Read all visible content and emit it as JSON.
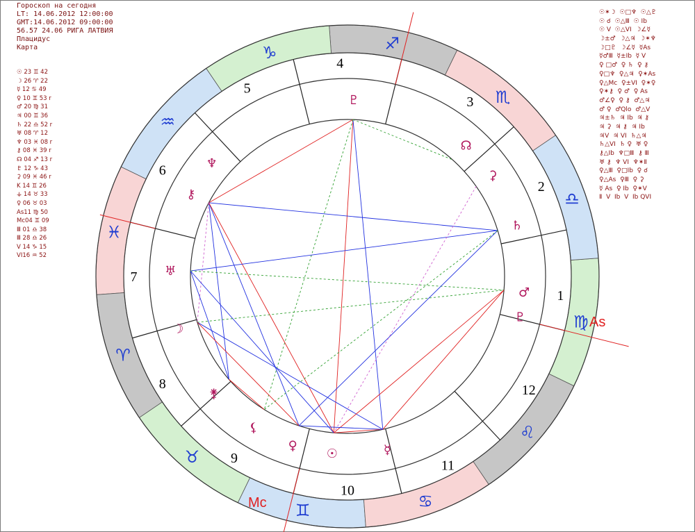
{
  "header": {
    "lines": [
      "Гороскоп на сегодня",
      "LT: 14.06.2012 12:00:00",
      "GMT:14.06.2012 09:00:00",
      "56.57 24.06 РИГА ЛАТВИЯ",
      "Плацидус",
      "Карта"
    ]
  },
  "planet_positions": [
    "☉ 23 ♊ 42",
    "☽ 26 ♈ 22",
    "☿ 12 ♋ 49",
    "♀ 10 ♊ 53 r",
    "♂ 20 ♍ 31",
    "♃ 00 ♊ 36",
    "♄ 22 ♎ 52 r",
    "♅ 08 ♈ 12",
    "♆ 03 ♓ 08 r",
    "⚷ 08 ♓ 39 r",
    "☊ 04 ♐ 13 r",
    "♇ 12 ♑ 43",
    "⚳ 09 ♓ 46 r",
    "K 14 ♊ 26",
    "⚶ 14 ♉ 33",
    "♀ 06 ♉ 03",
    "As11 ♍ 50",
    "Mc04 ♊ 09",
    "Ⅲ 01 ♎ 38",
    "Ⅲ 28 ♎ 26",
    "V 14 ♑ 15",
    "VI16 ♒ 52"
  ],
  "aspect_grid": [
    "☉✶☽  ☉□♆  ☉△♇",
    "☉ ☌  ☉△Ⅲ  ☉ Ib",
    "☉ V  ☉△VI  ☽∠☿",
    "☽±♂  ☽△♃  ☽✶♆",
    "☽□♇  ☽∠☿  ☿As",
    "☿♂Ⅲ  ☿±Ib  ☿ V",
    "♀ □♂  ♀ ♄  ♀ ⚷",
    "♀□♆  ♀△♃  ♀✶As",
    "♀△Mc  ♀±VI  ♀✶♀",
    "♀✶⚷  ♀ ♂  ♀ As",
    "♂∠♀  ♀ ⚷  ♂△♃",
    "♂ ♀  ♂Qlo  ♂△V",
    "♃±♄  ♃ Ib  ♃ ⚷",
    "♃ ⚳  ♃ ⚷  ♃ Ib",
    "♃V  ♃ VI  ♄△♃",
    "♄△VI  ♄ ♀  ♅ ♀",
    "⚷△Ib  ♆□Ⅲ  ⚷ Ⅲ",
    "♅ ⚷  ♆ VI  ♆✶Ⅱ",
    "♀△Ⅲ  ♀□Ib  ♀ ☌",
    "♀△As  ♀Ⅲ  ♀ ⚳",
    "☿ As  ♀ Ib  ♀✶V",
    "Ⅱ  V  Ib  V  Ib QVI"
  ],
  "houses": [
    "1",
    "2",
    "3",
    "4",
    "5",
    "6",
    "7",
    "8",
    "9",
    "10",
    "11",
    "12"
  ],
  "signs": [
    "♍",
    "♎",
    "♏",
    "♐",
    "♑",
    "♒",
    "♓",
    "♈",
    "♉",
    "♊",
    "♋",
    "♌"
  ],
  "planets": {
    "mars": "♂",
    "jupiter_pluto": "♇",
    "saturn": "♄",
    "node": "☊",
    "ceres": "⚳",
    "pluto": "♇",
    "neptune": "♆",
    "chiron": "⚷",
    "uranus": "♅",
    "moon": "☽",
    "juno": "⚵",
    "lilith": "⚸",
    "venus": "♀",
    "sun": "☉",
    "mercury": "☿"
  },
  "axes": {
    "asc": "As",
    "mc": "Mc"
  },
  "colors": {
    "fire": "#f8d5d5",
    "earth": "#c6c6c6",
    "air": "#d4f0d0",
    "water": "#cfe2f6",
    "sign_glyph": "#1f3dd1",
    "planet_glyph": "#b0165c",
    "axis": "#e02020",
    "aspect_red": "#e02020",
    "aspect_blue": "#2030e0",
    "aspect_green": "#30a030",
    "aspect_pink": "#d060d0"
  }
}
